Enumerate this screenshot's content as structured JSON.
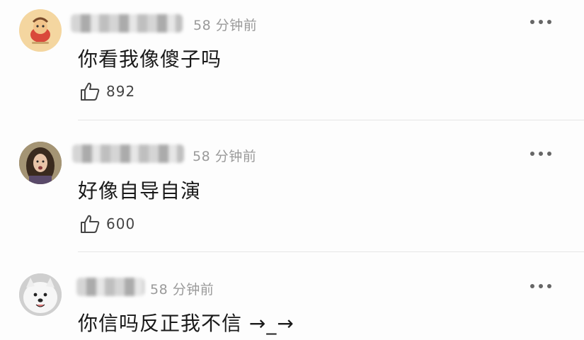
{
  "comments": [
    {
      "time": "58 分钟前",
      "text": "你看我像傻子吗",
      "likes": "892",
      "avatar": "cartoon-figure-avatar"
    },
    {
      "time": "58 分钟前",
      "text": "好像自导自演",
      "likes": "600",
      "avatar": "girl-photo-avatar"
    },
    {
      "time": "58 分钟前",
      "text": "你信吗反正我不信 →_→",
      "avatar": "dog-photo-avatar"
    }
  ],
  "icons": {
    "more": "more-dots-icon",
    "like": "thumbs-up-icon"
  }
}
